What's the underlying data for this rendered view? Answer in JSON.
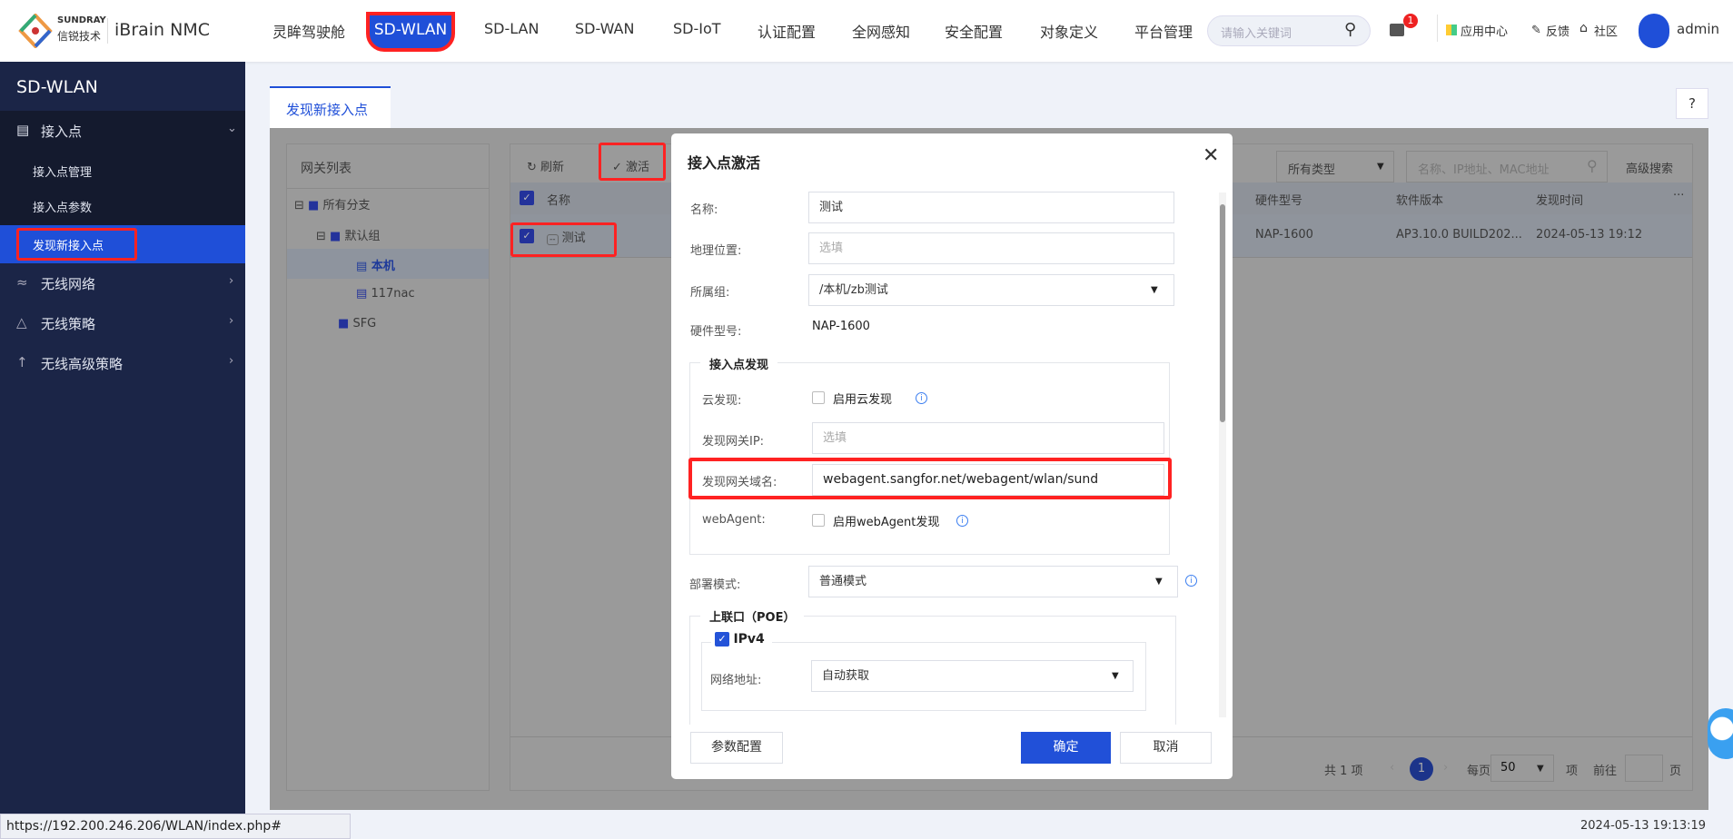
{
  "header": {
    "brand_en": "SUNDRAY",
    "brand_cn": "信锐技术",
    "product": "iBrain NMC",
    "nav": [
      "灵眸驾驶舱",
      "SD-WLAN",
      "SD-LAN",
      "SD-WAN",
      "SD-IoT",
      "认证配置",
      "全网感知",
      "安全配置",
      "对象定义",
      "平台管理"
    ],
    "active_nav": "SD-WLAN",
    "search_placeholder": "请输入关键词",
    "message_badge": "1",
    "app_center": "应用中心",
    "feedback": "反馈",
    "community": "社区",
    "user": "admin"
  },
  "sidebar": {
    "title": "SD-WLAN",
    "groups": [
      {
        "label": "接入点",
        "icon": "access-point-icon",
        "expanded": true,
        "items": [
          "接入点管理",
          "接入点参数",
          "发现新接入点"
        ],
        "active": "发现新接入点"
      },
      {
        "label": "无线网络",
        "icon": "wifi-icon"
      },
      {
        "label": "无线策略",
        "icon": "policy-icon"
      },
      {
        "label": "无线高级策略",
        "icon": "advanced-policy-icon"
      }
    ]
  },
  "tab": {
    "label": "发现新接入点"
  },
  "gateway_list": {
    "title": "网关列表",
    "tree": [
      "所有分支",
      "默认组",
      "本机",
      "117nac",
      "SFG"
    ],
    "selected": "本机"
  },
  "toolbar": {
    "refresh": "刷新",
    "activate": "激活",
    "type_filter": "所有类型",
    "search_placeholder": "名称、IP地址、MAC地址",
    "advanced_search": "高级搜索"
  },
  "table": {
    "columns": [
      "名称",
      "硬件型号",
      "软件版本",
      "发现时间"
    ],
    "more": "···",
    "rows": [
      {
        "name": "测试",
        "model": "NAP-1600",
        "version": "AP3.10.0 BUILD202...",
        "time": "2024-05-13 19:12",
        "checked": true
      }
    ]
  },
  "pagination": {
    "total": "共 1 项",
    "page": "1",
    "per_page_label": "每页",
    "per_page": "50",
    "unit": "项",
    "goto": "前往",
    "page_unit": "页"
  },
  "modal": {
    "title": "接入点激活",
    "name_label": "名称:",
    "name_value": "测试",
    "location_label": "地理位置:",
    "location_placeholder": "选填",
    "group_label": "所属组:",
    "group_value": "/本机/zb测试",
    "model_label": "硬件型号:",
    "model_value": "NAP-1600",
    "discovery_legend": "接入点发现",
    "cloud_label": "云发现:",
    "cloud_option": "启用云发现",
    "gw_ip_label": "发现网关IP:",
    "gw_ip_placeholder": "选填",
    "gw_domain_label": "发现网关域名:",
    "gw_domain_value": "webagent.sangfor.net/webagent/wlan/sund",
    "webagent_label": "webAgent:",
    "webagent_option": "启用webAgent发现",
    "deploy_label": "部署模式:",
    "deploy_value": "普通模式",
    "uplink_legend": "上联口（POE）",
    "ipv4_label": "IPv4",
    "net_addr_label": "网络地址:",
    "net_addr_value": "自动获取",
    "params_button": "参数配置",
    "ok_button": "确定",
    "cancel_button": "取消"
  },
  "statusbar": {
    "url": "https://192.200.246.206/WLAN/index.php#",
    "datetime": "2024-05-13 19:13:19"
  },
  "colors": {
    "primary": "#1f4fd8",
    "sidebar": "#1b2547",
    "highlight": "#ff2222"
  }
}
